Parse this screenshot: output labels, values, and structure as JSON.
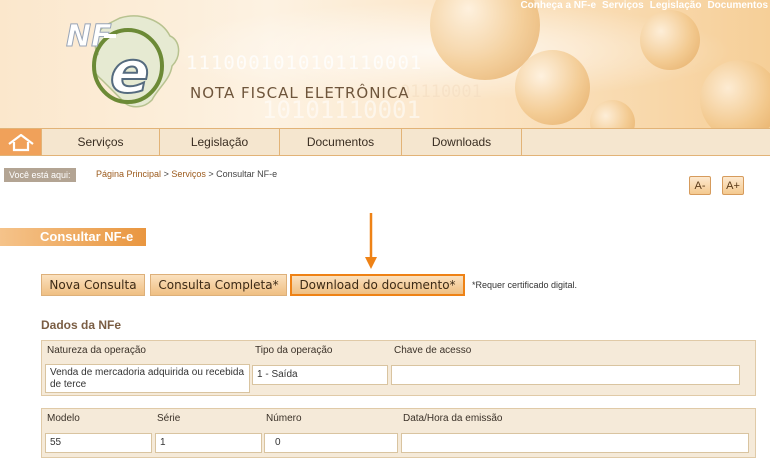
{
  "header": {
    "logo_text": "NF-e",
    "brand_name": "NOTA FISCAL ELETRÔNICA",
    "binary_line_1": "1110001010101110001",
    "binary_line_2": "10101110001",
    "binary_line_3": "01110001",
    "top_links": [
      "Conheça a NF-e",
      "Serviços",
      "Legislação",
      "Documentos"
    ]
  },
  "nav": {
    "items": [
      "Serviços",
      "Legislação",
      "Documentos",
      "Downloads"
    ]
  },
  "breadcrumb": {
    "label": "Você está aqui:",
    "home": "Página Principal",
    "sep": ">",
    "services": "Serviços",
    "current": "Consultar NF-e"
  },
  "font_controls": {
    "decrease": "A-",
    "increase": "A+"
  },
  "page": {
    "title": "Consultar NF-e",
    "buttons": {
      "nova_consulta": "Nova Consulta",
      "consulta_completa": "Consulta Completa*",
      "download": "Download do documento*"
    },
    "note": "*Requer certificado digital.",
    "section_title": "Dados da NFe"
  },
  "nfe": {
    "natureza_label": "Natureza da operação",
    "natureza_value": "Venda de mercadoria adquirida ou recebida de terce",
    "tipo_label": "Tipo da operação",
    "tipo_value": "1 - Saída",
    "chave_label": "Chave de acesso",
    "chave_value": "",
    "modelo_label": "Modelo",
    "modelo_value": "55",
    "serie_label": "Série",
    "serie_value": "1",
    "numero_label": "Número",
    "numero_value": "0",
    "data_label": "Data/Hora da emissão",
    "data_value": ""
  },
  "colors": {
    "accent": "#ee8216",
    "title_bar": "#e9963f",
    "panel_bg": "#f5ead9"
  },
  "icons": [
    "home-icon",
    "arrow-down-icon",
    "brazil-map-icon"
  ]
}
